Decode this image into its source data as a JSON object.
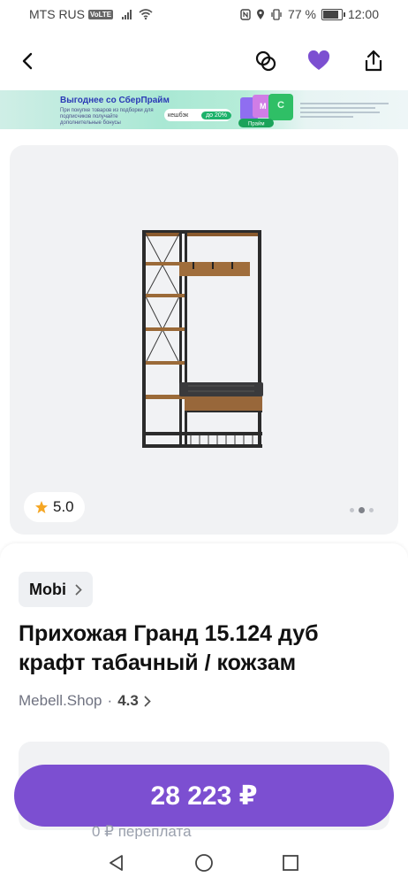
{
  "status_bar": {
    "carrier": "MTS RUS",
    "volte": "VoLTE",
    "battery": "77 %",
    "time": "12:00"
  },
  "banner": {
    "title": "Выгоднее со СберПрайм",
    "subtitle": "При покупке товаров из подборки для подписчиков получайте дополнительные бонусы",
    "cashback_label": "кешбэк",
    "cashback_pct": "до 20%",
    "badge": "Прайм"
  },
  "gallery": {
    "rating": "5.0",
    "slides_total": 3,
    "active_slide": 2
  },
  "product": {
    "brand": "Mobi",
    "title": "Прихожая Гранд 15.124 дуб крафт табачный / кожзам",
    "seller": "Mebell.Shop",
    "separator": "·",
    "seller_rating": "4.3",
    "price": "28 223 ₽",
    "overpay": "0 ₽ переплата"
  },
  "colors": {
    "accent": "#7c4fd1",
    "star": "#f5a623"
  },
  "icons": {
    "back": "chevron-left-icon",
    "compare": "compare-icon",
    "favorite": "heart-icon",
    "share": "share-icon"
  }
}
